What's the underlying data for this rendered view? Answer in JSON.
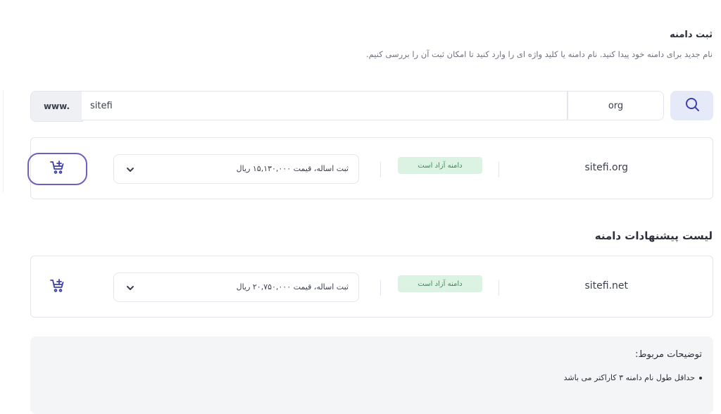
{
  "header": {
    "title": "ثبت دامنه",
    "subtitle": "نام جدید برای دامنه خود پیدا کنید. نام دامنه یا کلید واژه ای را وارد کنید تا امکان ثبت آن را بررسی کنیم."
  },
  "search": {
    "prefix": "www.",
    "value": "sitefi",
    "tld": "org",
    "button_icon": "search-icon"
  },
  "result": {
    "domain": "sitefi.org",
    "status": "دامنه آزاد است",
    "price_option": "ثبت اساله، قیمت ۱۵,۱۳۰,۰۰۰ ریال",
    "cart_icon": "add-to-cart-icon"
  },
  "suggestions": {
    "title": "لیست پیشنهادات دامنه",
    "items": [
      {
        "domain": "sitefi.net",
        "status": "دامنه آزاد است",
        "price_option": "ثبت اساله، قیمت ۲۰,۷۵۰,۰۰۰ ریال",
        "cart_icon": "add-to-cart-icon"
      }
    ]
  },
  "notes": {
    "title": "توضیحات مربوط:",
    "items": [
      "حداقل طول نام دامنه ۳ کاراکتر می باشد"
    ]
  },
  "colors": {
    "accent": "#3c3fb0",
    "focus_border": "#6d5fc5",
    "badge_bg": "#dcf3e3",
    "badge_text": "#3c8a55",
    "search_btn_bg": "#e6e9f7"
  }
}
